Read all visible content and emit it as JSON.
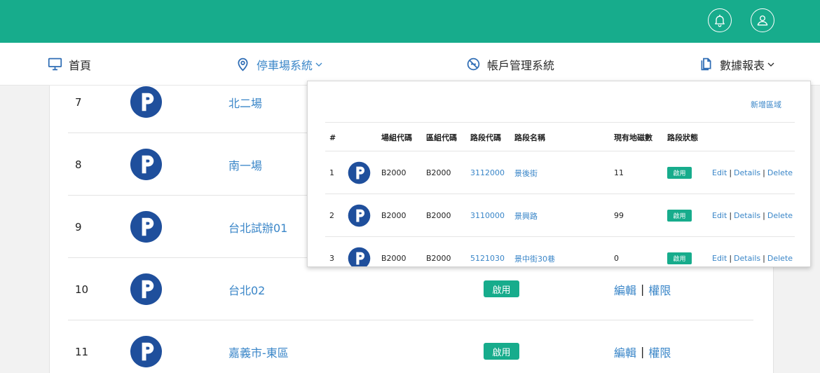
{
  "header": {
    "bell_icon": "bell-icon",
    "user_icon": "user-icon",
    "accent_color": "#17ac8c"
  },
  "nav": {
    "items": [
      {
        "label": "首頁",
        "icon": "monitor-icon"
      },
      {
        "label": "停車場系統",
        "icon": "map-pin-icon"
      },
      {
        "label": "帳戶管理系統",
        "icon": "no-entry-icon"
      },
      {
        "label": "數據報表",
        "icon": "documents-icon"
      }
    ]
  },
  "lots": {
    "rows": [
      {
        "num": "7",
        "name": "北二場",
        "status": "",
        "edit": "",
        "perm": ""
      },
      {
        "num": "8",
        "name": "南一場",
        "status": "",
        "edit": "",
        "perm": ""
      },
      {
        "num": "9",
        "name": "台北試辦01",
        "status": "",
        "edit": "",
        "perm": ""
      },
      {
        "num": "10",
        "name": "台北02",
        "status": "啟用",
        "edit": "編輯",
        "perm": "權限"
      },
      {
        "num": "11",
        "name": "嘉義市-東區",
        "status": "啟用",
        "edit": "編輯",
        "perm": "權限"
      }
    ]
  },
  "panel": {
    "add_label": "新增區域",
    "headers": [
      "#",
      "場組代碼",
      "區組代碼",
      "路段代碼",
      "路段名稱",
      "現有地磁數",
      "路段狀態"
    ],
    "rows": [
      {
        "num": "1",
        "group": "B2000",
        "area": "B2000",
        "code": "3112000",
        "name": "景後街",
        "count": "11",
        "status": "啟用",
        "edit": "Edit",
        "details": "Details",
        "delete": "Delete"
      },
      {
        "num": "2",
        "group": "B2000",
        "area": "B2000",
        "code": "3110000",
        "name": "景興路",
        "count": "99",
        "status": "啟用",
        "edit": "Edit",
        "details": "Details",
        "delete": "Delete"
      },
      {
        "num": "3",
        "group": "B2000",
        "area": "B2000",
        "code": "5121030",
        "name": "景中街30巷",
        "count": "0",
        "status": "啟用",
        "edit": "Edit",
        "details": "Details",
        "delete": "Delete"
      }
    ]
  }
}
